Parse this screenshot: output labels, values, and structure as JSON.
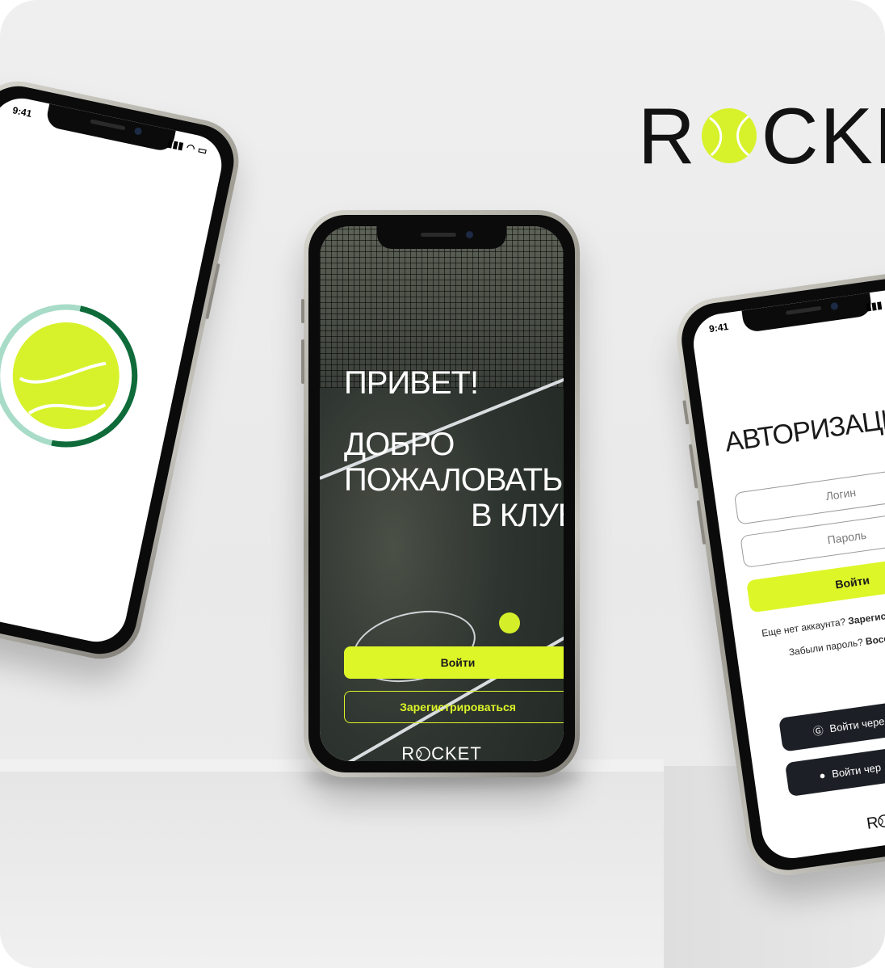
{
  "brand": {
    "name_before": "R",
    "name_after": "CKET",
    "ball_icon": "tennis-ball-icon"
  },
  "colors": {
    "accent": "#DDF628",
    "dark": "#1C1F25",
    "ring_light": "#A8DCC8",
    "ring_dark": "#0F6B3A"
  },
  "left_phone": {
    "time": "9:41"
  },
  "center_phone": {
    "greeting": "ПРИВЕТ!",
    "welcome_line1": "ДОБРО",
    "welcome_line2": "ПОЖАЛОВАТЬ",
    "welcome_line3": "В КЛУБ",
    "login_label": "Войти",
    "register_label": "Зарегистрироваться",
    "brand_before": "R",
    "brand_after": "CKET"
  },
  "right_phone": {
    "time": "9:41",
    "title": "АВТОРИЗАЦИ",
    "login_placeholder": "Логин",
    "password_placeholder": "Пароль",
    "login_button": "Войти",
    "no_account_text": "Еще нет аккаунта?",
    "register_link": "Зарегист",
    "forgot_text": "Забыли пароль?",
    "restore_link": "Восст",
    "google_button": "Войти чере",
    "apple_button": "Войти чер",
    "brand_before": "R"
  }
}
